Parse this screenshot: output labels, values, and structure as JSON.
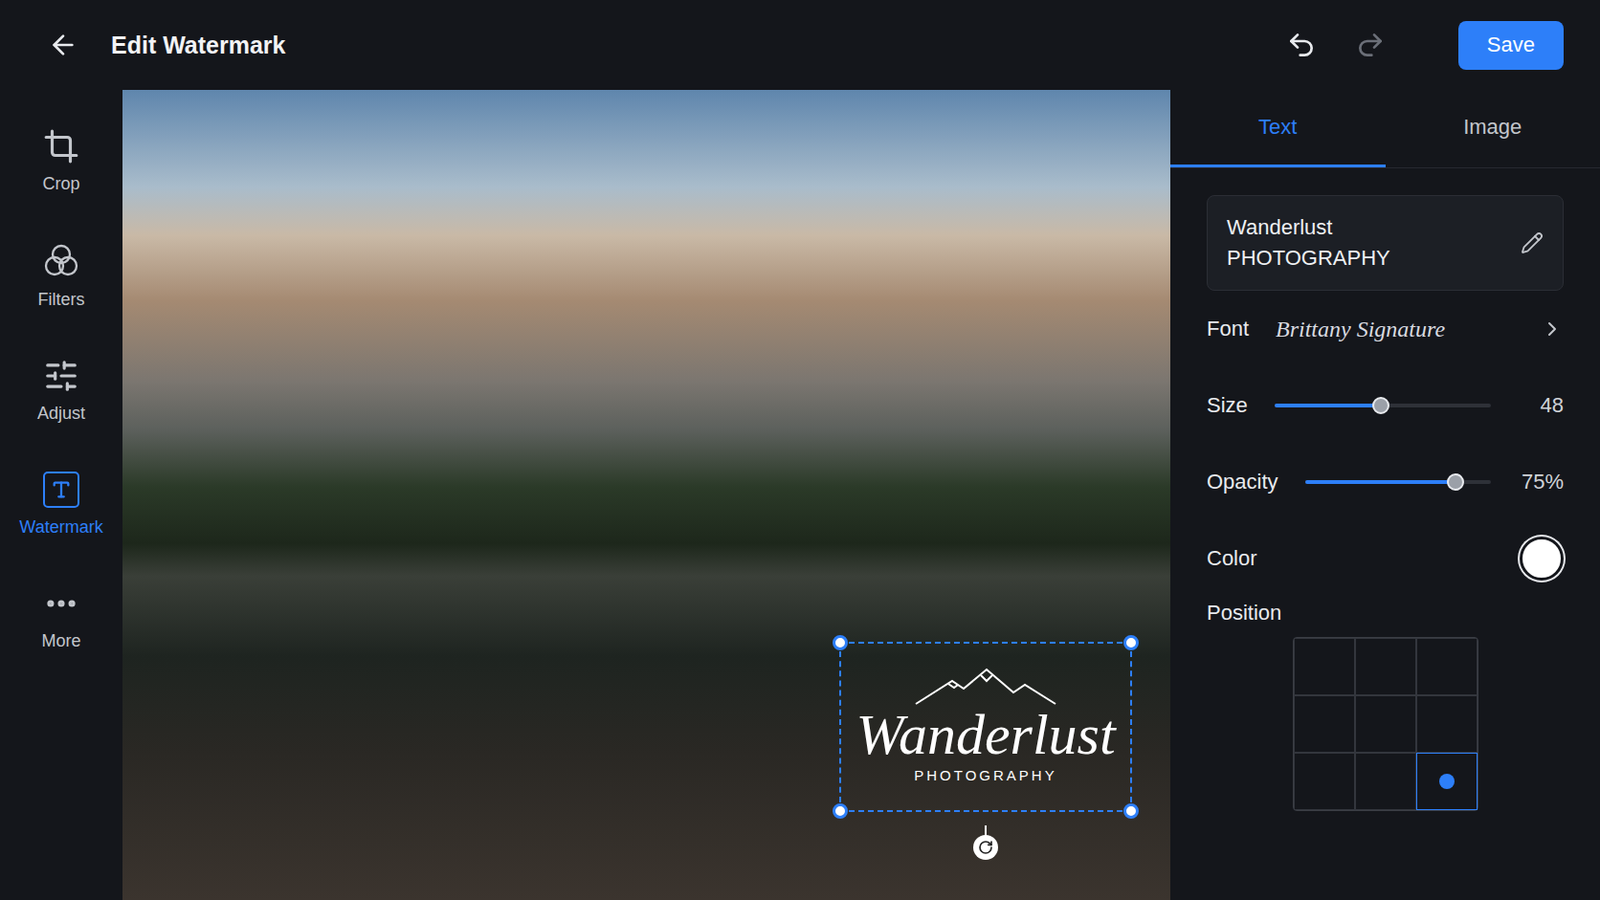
{
  "window": {
    "title": "Edit Watermark"
  },
  "toolbar": {
    "save": "Save",
    "undo_enabled": true,
    "redo_enabled": false
  },
  "sidebar": {
    "items": [
      {
        "label": "Crop",
        "selected": false,
        "kind": "crop"
      },
      {
        "label": "Filters",
        "selected": false,
        "kind": "filters"
      },
      {
        "label": "Adjust",
        "selected": false,
        "kind": "adjust"
      },
      {
        "label": "Watermark",
        "selected": true,
        "kind": "watermark"
      },
      {
        "label": "More",
        "selected": false,
        "kind": "more"
      }
    ]
  },
  "panel": {
    "tabs": [
      {
        "label": "Text",
        "selected": true
      },
      {
        "label": "Image",
        "selected": false
      }
    ],
    "text_value": [
      "Wanderlust",
      "PHOTOGRAPHY"
    ],
    "font": {
      "label": "Font",
      "value": "Brittany Signature"
    },
    "size": {
      "label": "Size",
      "level": 0.49,
      "reading": "48"
    },
    "opacity": {
      "label": "Opacity",
      "level": 0.81,
      "reading": "75%"
    },
    "color": {
      "label": "Color",
      "value": "#ffffff"
    },
    "position": {
      "label": "Position",
      "cells": [
        {
          "selected": false
        },
        {
          "selected": false
        },
        {
          "selected": false
        },
        {
          "selected": false
        },
        {
          "selected": false
        },
        {
          "selected": false
        },
        {
          "selected": false
        },
        {
          "selected": false
        },
        {
          "selected": true
        }
      ]
    }
  },
  "watermark": {
    "title": "Wanderlust",
    "subtitle": "PHOTOGRAPHY",
    "selected": true,
    "opacity": 0.75
  }
}
